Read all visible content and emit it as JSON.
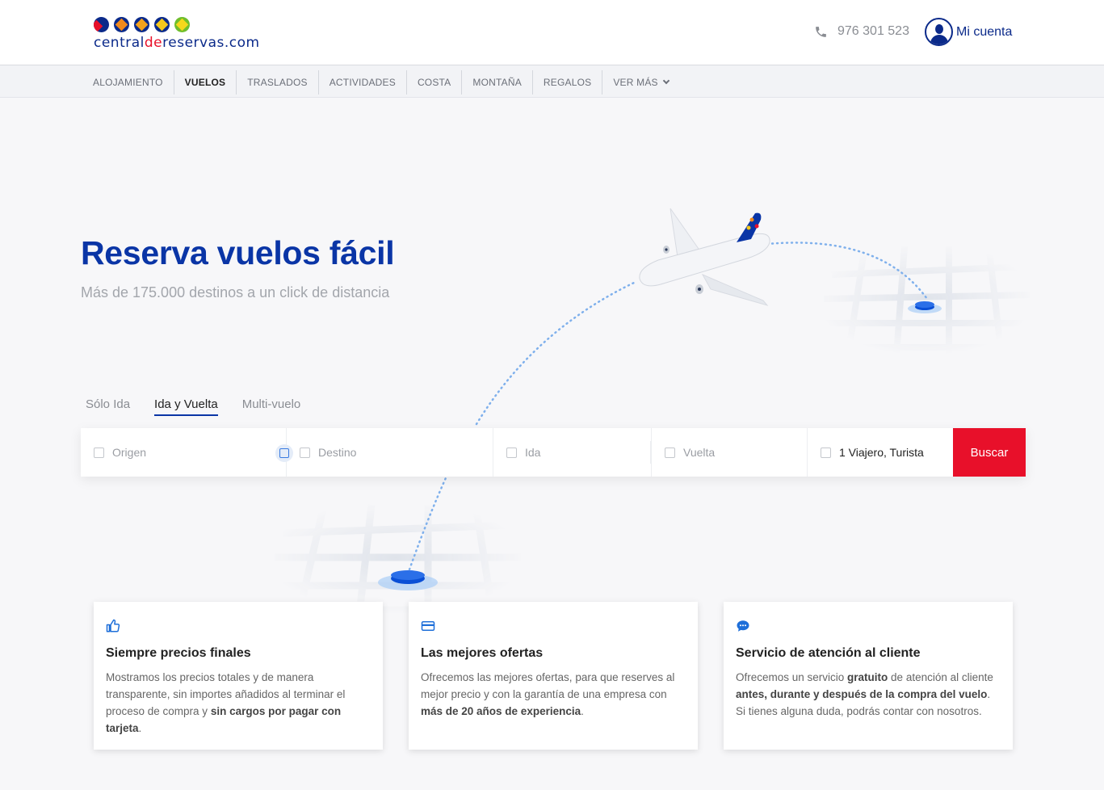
{
  "header": {
    "logo": {
      "main": "central",
      "highlight": "de",
      "rest": "reservas.com"
    },
    "phone": "976 301 523",
    "account_label": "Mi cuenta"
  },
  "nav": {
    "items": [
      "ALOJAMIENTO",
      "VUELOS",
      "TRASLADOS",
      "ACTIVIDADES",
      "COSTA",
      "MONTAÑA",
      "REGALOS",
      "VER MÁS"
    ],
    "active": "VUELOS"
  },
  "hero": {
    "title": "Reserva vuelos fácil",
    "subtitle": "Más de 175.000 destinos a un click de distancia"
  },
  "trip_tabs": {
    "items": [
      "Sólo Ida",
      "Ida y Vuelta",
      "Multi-vuelo"
    ],
    "active": "Ida y Vuelta"
  },
  "search": {
    "origen_placeholder": "Origen",
    "destino_placeholder": "Destino",
    "ida_placeholder": "Ida",
    "vuelta_placeholder": "Vuelta",
    "passengers": "1 Viajero, Turista",
    "button": "Buscar"
  },
  "features": [
    {
      "icon": "thumbs-up-icon",
      "title": "Siempre precios finales",
      "text_before": "Mostramos los precios totales y de manera transparente, sin importes añadidos al terminar el proceso de compra y ",
      "bold": "sin cargos por pagar con tarjeta",
      "text_after": "."
    },
    {
      "icon": "credit-card-icon",
      "title": "Las mejores ofertas",
      "text_before": "Ofrecemos las mejores ofertas, para que reserves al mejor precio y con la garantía de una empresa con ",
      "bold": "más de 20 años de experiencia",
      "text_after": "."
    },
    {
      "icon": "chat-bubble-icon",
      "title": "Servicio de atención al cliente",
      "text_before": "Ofrecemos un servicio ",
      "bold": "gratuito",
      "text_middle": " de atención al cliente ",
      "bold2": "antes, durante y después de la compra del vuelo",
      "text_after": ". Si tienes alguna duda, podrás contar con nosotros."
    }
  ],
  "colors": {
    "brand_blue": "#0a35a6",
    "accent_red": "#e8102a",
    "page_bg": "#f7f7f9"
  }
}
